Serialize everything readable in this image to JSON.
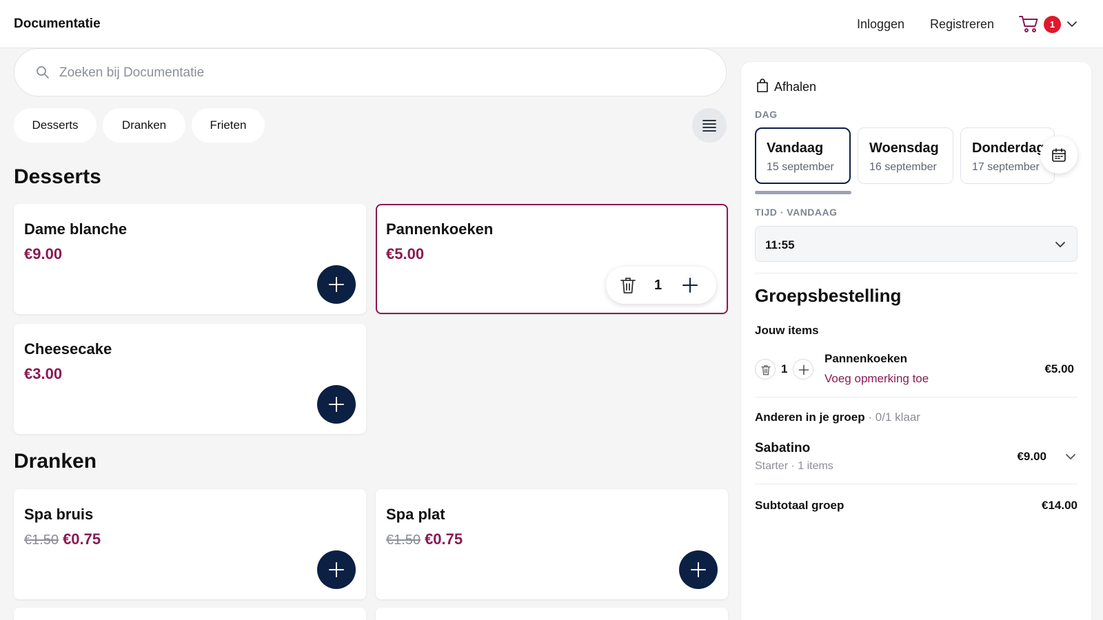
{
  "header": {
    "brand": "Documentatie",
    "login": "Inloggen",
    "register": "Registreren",
    "cart_count": "1"
  },
  "search": {
    "placeholder": "Zoeken bij Documentatie"
  },
  "categories": [
    "Desserts",
    "Dranken",
    "Frieten"
  ],
  "sections": [
    {
      "title": "Desserts",
      "products": [
        {
          "name": "Dame blanche",
          "price": "€9.00"
        },
        {
          "name": "Pannenkoeken",
          "price": "€5.00",
          "quantity": "1"
        },
        {
          "name": "Cheesecake",
          "price": "€3.00"
        }
      ]
    },
    {
      "title": "Dranken",
      "products": [
        {
          "name": "Spa bruis",
          "old_price": "€1.50",
          "price": "€0.75"
        },
        {
          "name": "Spa plat",
          "old_price": "€1.50",
          "price": "€0.75"
        }
      ]
    }
  ],
  "order": {
    "mode": "Afhalen",
    "day_label": "DAG",
    "days": [
      {
        "name": "Vandaag",
        "date": "15 september"
      },
      {
        "name": "Woensdag",
        "date": "16 september"
      },
      {
        "name": "Donderdag",
        "date": "17 september"
      }
    ],
    "time_label": "TIJD · VANDAAG",
    "time_value": "11:55",
    "group_title": "Groepsbestelling",
    "your_items_label": "Jouw items",
    "your_items": [
      {
        "qty": "1",
        "name": "Pannenkoeken",
        "note": "Voeg opmerking toe",
        "price": "€5.00"
      }
    ],
    "others_label": "Anderen in je groep",
    "others_status": " · 0/1 klaar",
    "members": [
      {
        "name": "Sabatino",
        "sub": "Starter · 1 items",
        "price": "€9.00"
      }
    ],
    "subtotal_label": "Subtotaal groep",
    "subtotal_value": "€14.00"
  },
  "colors": {
    "accent": "#8a1a52",
    "primary": "#0c2044",
    "badge": "#e0182d"
  }
}
